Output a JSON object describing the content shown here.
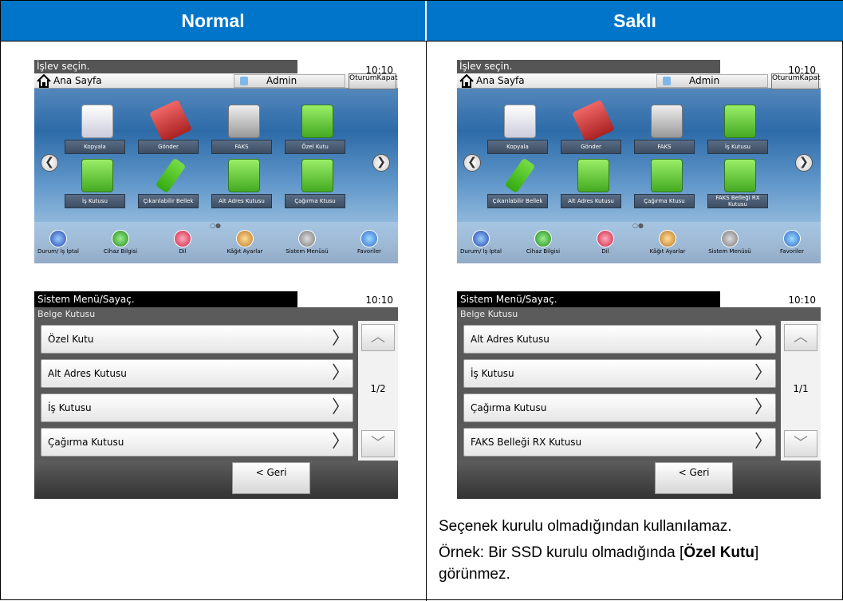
{
  "header": {
    "left": "Normal",
    "right": "Saklı"
  },
  "home_common": {
    "function_title": "İşlev seçin.",
    "clock": "10:10",
    "home_label": "Ana Sayfa",
    "user": "Admin",
    "logout": "OturumKapat",
    "prev": "❮",
    "next": "❯",
    "dots": "○●",
    "bottom": [
      "Durum/ İş İptal",
      "Cihaz Bilgisi",
      "Dil",
      "Kâğıt Ayarlar",
      "Sistem Menüsü",
      "Favoriler"
    ]
  },
  "home_left": {
    "tiles": [
      "Kopyala",
      "Gönder",
      "FAKS",
      "Özel Kutu",
      "İş Kutusu",
      "Çıkarılabilir Bellek",
      "Alt Adres Kutusu",
      "Çağırma Ktusu"
    ],
    "icons": [
      "copy-icon",
      "send-icon",
      "fax-icon",
      "box-icon",
      "box-icon",
      "usb-icon",
      "box-icon",
      "box-icon"
    ]
  },
  "home_right": {
    "tiles": [
      "Kopyala",
      "Gönder",
      "FAKS",
      "İş Kutusu",
      "Çıkarılabilir Bellek",
      "Alt Adres Kutusu",
      "Çağırma Ktusu",
      "FAKS Belleği RX Kutusu"
    ],
    "icons": [
      "copy-icon",
      "send-icon",
      "fax-icon",
      "box-icon",
      "usb-icon",
      "box-icon",
      "box-icon",
      "box-icon"
    ]
  },
  "menu_common": {
    "title": "Sistem Menü/Sayaç.",
    "clock": "10:10",
    "subtitle": "Belge Kutusu",
    "up": "︿",
    "down": "﹀",
    "chev": "〉",
    "back": "< Geri"
  },
  "menu_left": {
    "items": [
      "Özel Kutu",
      "Alt Adres Kutusu",
      "İş Kutusu",
      "Çağırma Kutusu"
    ],
    "page": "1/2"
  },
  "menu_right": {
    "items": [
      "Alt Adres Kutusu",
      "İş Kutusu",
      "Çağırma Kutusu",
      "FAKS Belleği RX Kutusu"
    ],
    "page": "1/1"
  },
  "note": {
    "line1": "Seçenek kurulu olmadığından kullanılamaz.",
    "line2_a": "Örnek: Bir SSD kurulu olmadığında [",
    "line2_b": "Özel Kutu",
    "line2_c": "]",
    "line3": "görünmez."
  }
}
